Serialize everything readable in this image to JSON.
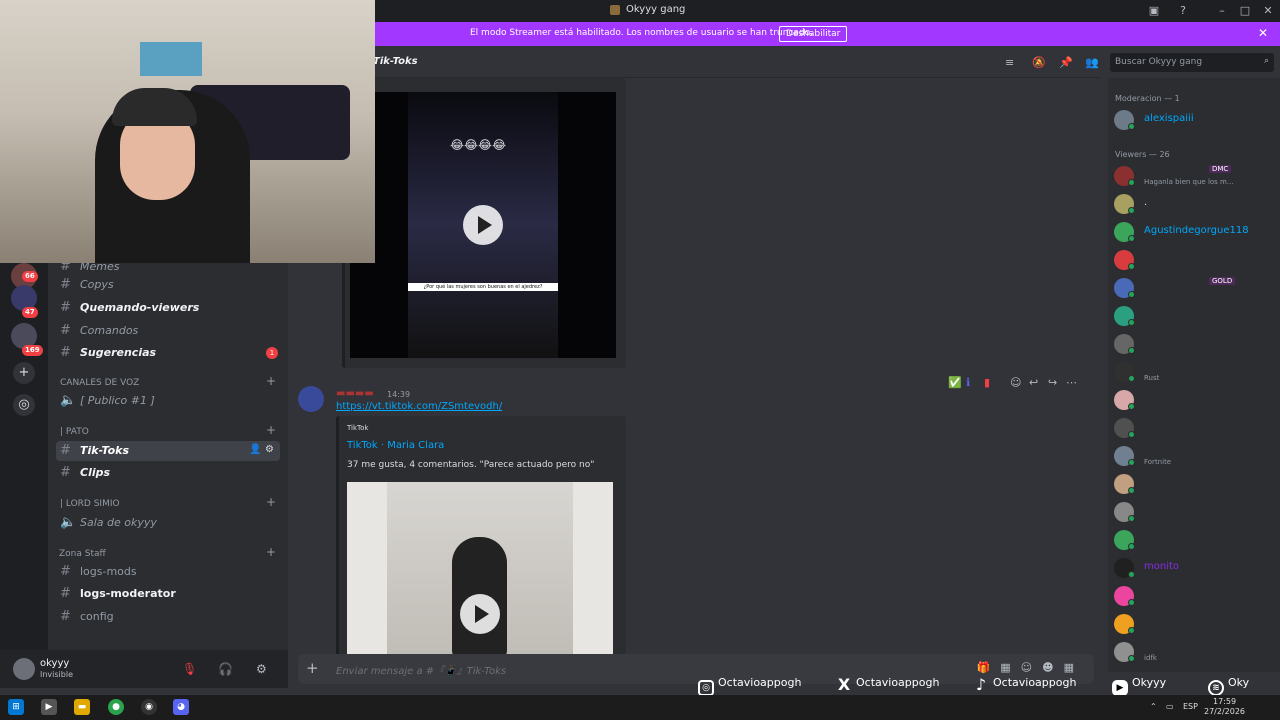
{
  "window": {
    "title": "Okyyy gang"
  },
  "streamer_banner": {
    "message": "El modo Streamer está habilitado. Los nombres de usuario se han truncado.",
    "disable_label": "Deshabilitar"
  },
  "guilds": {
    "badges": [
      "66",
      "47",
      "169"
    ]
  },
  "channels": {
    "items": [
      {
        "name": "Memes",
        "prefix": "『 』"
      },
      {
        "name": "Copys",
        "prefix": "『📚』"
      },
      {
        "name": "Quemando-viewers",
        "prefix": "『♿』"
      },
      {
        "name": "Comandos",
        "prefix": "『⚙』"
      },
      {
        "name": "Sugerencias",
        "prefix": "『🤔』",
        "unread": "1"
      }
    ],
    "voice_category": "CANALES DE VOZ",
    "voice_items": [
      {
        "name": "[ Publico #1 ]",
        "prefix": "『📢』"
      }
    ],
    "pato_category": "| PATO",
    "pato_items": [
      {
        "name": "Tik-Toks",
        "prefix": "『📱』"
      },
      {
        "name": "Clips",
        "prefix": "『🎬』"
      }
    ],
    "lord_category": "| LORD SIMIO",
    "lord_items": [
      {
        "name": "Sala de okyyy",
        "prefix": "『😺』"
      }
    ],
    "staff_category": "Zona Staff",
    "staff_items": [
      "logs-mods",
      "logs-moderator",
      "config"
    ]
  },
  "user": {
    "name": "okyyy",
    "status": "Invisible"
  },
  "chat": {
    "channel_name": "Tik-Toks",
    "top_embed": {
      "caption": "¿Por qué las mujeres son buenas en el ajedrez?",
      "emoji": "😂😂😂😂"
    },
    "message": {
      "time": "14:39",
      "link": "https://vt.tiktok.com/ZSmtevodh/",
      "embed_provider": "TikTok",
      "embed_title": "TikTok · Maria Clara",
      "embed_desc": "37 me gusta, 4 comentarios. \"Parece actuado pero no\""
    },
    "composer_placeholder": "Enviar mensaje a #『📱』Tik-Toks"
  },
  "search": {
    "placeholder": "Buscar Okyyy gang"
  },
  "members": {
    "moderation_header": "Moderacion — 1",
    "moderation": [
      {
        "name": "alexispaiii",
        "color": "#00a8fc"
      }
    ],
    "viewers_header": "Viewers — 26",
    "viewers": [
      {
        "name": "",
        "tag": "DMC",
        "sub": "Haganla bien que los m...",
        "color": "#a33"
      },
      {
        "name": ".",
        "color": "#dbdee1"
      },
      {
        "name": "Agustindegorgue118",
        "color": "#00a8fc"
      },
      {
        "name": "",
        "color": "#a33"
      },
      {
        "name": "",
        "tag": "GOLD",
        "color": "#a33"
      },
      {
        "name": "",
        "color": "#a33"
      },
      {
        "name": "",
        "color": "#a33"
      },
      {
        "name": "",
        "sub": "Rust",
        "color": "#a33"
      },
      {
        "name": "",
        "color": "#a33"
      },
      {
        "name": "",
        "color": "#a33"
      },
      {
        "name": "",
        "sub": "Fortnite",
        "color": "#a33"
      },
      {
        "name": "",
        "color": "#a33"
      },
      {
        "name": "",
        "color": "#a33"
      },
      {
        "name": "",
        "color": "#a33"
      },
      {
        "name": "monito",
        "color": "#8a2be2"
      },
      {
        "name": "",
        "color": "#a33"
      },
      {
        "name": "",
        "color": "#a33"
      },
      {
        "name": "",
        "sub": "idfk",
        "color": "#a33"
      }
    ]
  },
  "socials": [
    {
      "icon": "instagram-icon",
      "handle": "Octavioappogh"
    },
    {
      "icon": "x-icon",
      "handle": "Octavioappogh"
    },
    {
      "icon": "tiktok-icon",
      "handle": "Octavioappogh"
    },
    {
      "icon": "youtube-icon",
      "handle": "Okyyy"
    },
    {
      "icon": "spotify-icon",
      "handle": "Oky"
    }
  ],
  "taskbar": {
    "lang": "ESP",
    "time": "17:59",
    "date": "27/2/2026"
  },
  "colors": {
    "blurple": "#5865f2",
    "streamer": "#a238ff",
    "link": "#00a8fc",
    "danger": "#f23f43"
  }
}
